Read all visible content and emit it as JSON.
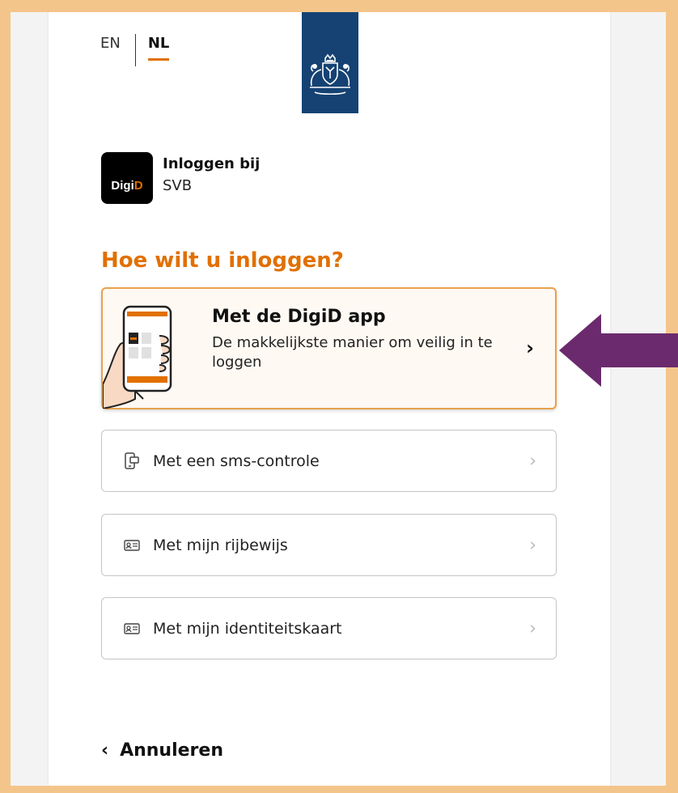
{
  "language": {
    "options": [
      "EN",
      "NL"
    ],
    "active": "NL"
  },
  "brand": {
    "logo_text_part1": "Digi",
    "logo_text_part2": "D",
    "title": "Inloggen bij",
    "subtitle": "SVB"
  },
  "heading": "Hoe wilt u inloggen?",
  "featured_option": {
    "title": "Met de DigiD app",
    "description": "De makkelijkste manier om veilig in te loggen",
    "icon": "phone-in-hand-illustration"
  },
  "options": [
    {
      "label": "Met een sms-controle",
      "icon": "sms-phone-icon"
    },
    {
      "label": "Met mijn rijbewijs",
      "icon": "id-card-icon"
    },
    {
      "label": "Met mijn identiteitskaart",
      "icon": "id-card-icon"
    }
  ],
  "cancel": {
    "label": "Annuleren"
  },
  "colors": {
    "accent": "#e17000",
    "gov_blue": "#154273",
    "annotation_arrow": "#6b2a6e",
    "frame": "#f4c58a"
  }
}
